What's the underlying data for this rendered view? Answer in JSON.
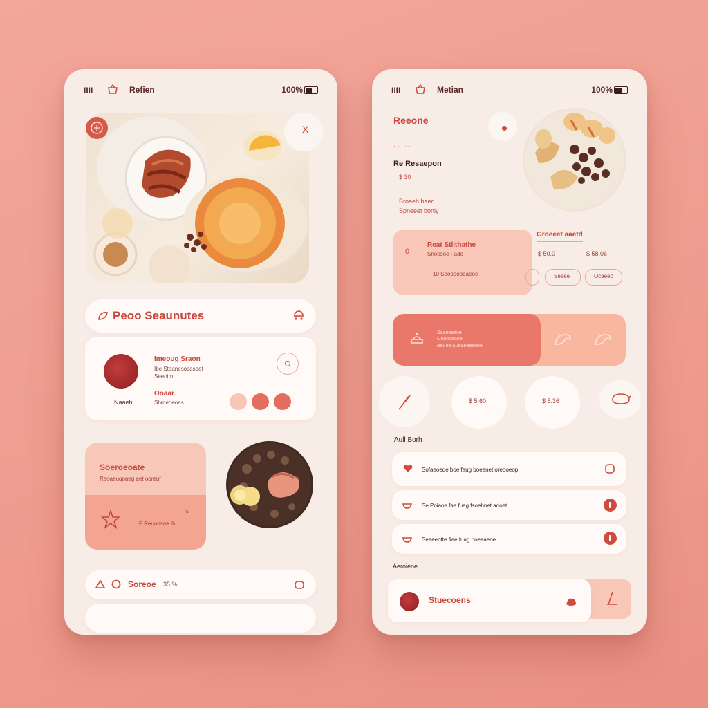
{
  "left": {
    "status": {
      "title": "Refien",
      "battery": "100%"
    },
    "hero_close": "X",
    "section": {
      "title": "Peoo Seaunutes"
    },
    "item": {
      "title": "Imeoug Sraon",
      "line1": "Ibe Stoanesosasoet",
      "line2": "Seeoim",
      "label": "Naaeh",
      "sub_title": "Ooaar",
      "sub_line": "Sbmeoeoas"
    },
    "promo": {
      "title": "Soeroeoate",
      "subtitle": "Reoaeuqoaeg aet ooreuf",
      "foot": "F Reuoosae Ih"
    },
    "bottom": {
      "title": "Soreoe",
      "value": "35.%"
    }
  },
  "right": {
    "status": {
      "title": "Metian",
      "battery": "100%"
    },
    "header": {
      "title": "Reeone",
      "dots": "· · · · ·",
      "subtitle": "Re Resaepon",
      "price": "$ 30",
      "note1": "Broaeh haed",
      "note2": "Spneeet bonly"
    },
    "offer": {
      "title": "Reat Stlithathe",
      "line": "Srioesoe Fade",
      "badge": "0",
      "foot": "10 Seoooooaaeoe"
    },
    "side": {
      "title": "Groeeet aaetd",
      "v1": "$ 50.0",
      "v2": "$ 58.06",
      "b1": "Seaee",
      "b2": "Ocaeeo"
    },
    "banner": {
      "line1": "Saaeeeaoe",
      "line2": "Oooooaaoe",
      "line3": "Beuoe Sueaeeeaeee"
    },
    "circles": [
      "$ 5.60",
      "$ 5.36"
    ],
    "list_header": "Aull Borh",
    "list": [
      "Sofaeoede boe faug boeenet oreooeop",
      "Se Poiaoe fae fuag fsoebnet adoet",
      "Seeeeotte fiae fuag boeeaeoe"
    ],
    "bottom_header": "Aeroiene",
    "bottom": {
      "title": "Stuecoens"
    }
  },
  "colors": {
    "accent": "#d04a3e",
    "accent_soft": "#f3b7a6",
    "card": "#fffaf7",
    "phone": "#f8ece6",
    "background": "#ef9f92"
  }
}
